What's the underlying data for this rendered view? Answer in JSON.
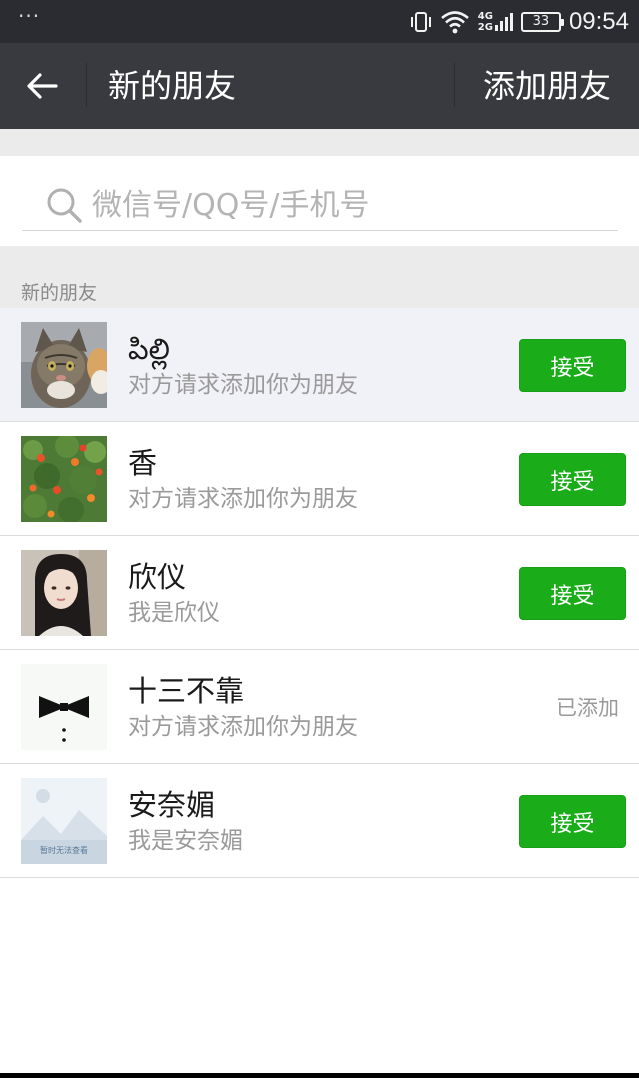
{
  "status_bar": {
    "menu_dots": "···",
    "net_top": "4G",
    "net_bottom": "2G",
    "battery": "33",
    "time": "09:54"
  },
  "title_bar": {
    "title": "新的朋友",
    "action": "添加朋友",
    "back_icon": "arrow-left-icon"
  },
  "search": {
    "placeholder": "微信号/QQ号/手机号",
    "value": ""
  },
  "section": {
    "label": "新的朋友"
  },
  "friends": [
    {
      "name": "పిల్లి",
      "message": "对方请求添加你为朋友",
      "status": "accept",
      "button": "接受"
    },
    {
      "name": "香",
      "message": "对方请求添加你为朋友",
      "status": "accept",
      "button": "接受"
    },
    {
      "name": "欣仪",
      "message": "我是欣仪",
      "status": "accept",
      "button": "接受"
    },
    {
      "name": "十三不靠",
      "message": "对方请求添加你为朋友",
      "status": "added",
      "added_text": "已添加"
    },
    {
      "name": "安奈媚",
      "message": "我是安奈媚",
      "status": "accept",
      "button": "接受",
      "avatar_text": "暂时无法查看"
    }
  ],
  "colors": {
    "status_bar": "#2a2c31",
    "title_bar": "#393a3f",
    "accent_green": "#1aad19",
    "background": "#ebebeb"
  }
}
